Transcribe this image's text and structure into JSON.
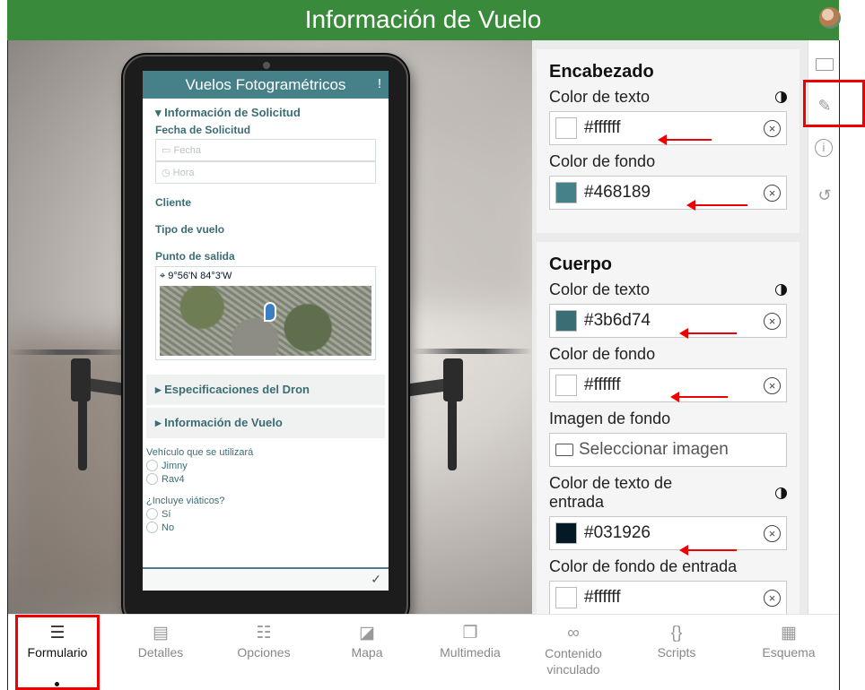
{
  "app": {
    "title": "Información de Vuelo"
  },
  "preview": {
    "form_title": "Vuelos Fotogramétricos",
    "header_icon": "!",
    "sections": {
      "solicitud": "Información de Solicitud",
      "dron": "Especificaciones del Dron",
      "vuelo": "Información de Vuelo"
    },
    "fields": {
      "fecha_solicitud": "Fecha de Solicitud",
      "fecha_placeholder": "Fecha",
      "hora_placeholder": "Hora",
      "cliente": "Cliente",
      "tipo_vuelo": "Tipo de vuelo",
      "punto_salida": "Punto de salida",
      "coordenadas": "9°56'N 84°3'W",
      "vehiculo": "Vehículo que se utilizará",
      "vehiculo_options": [
        "Jimny",
        "Rav4"
      ],
      "viaticos": "¿Incluye viáticos?",
      "viaticos_options": [
        "Sí",
        "No"
      ]
    }
  },
  "panel": {
    "encabezado": {
      "title": "Encabezado",
      "text_color_label": "Color de texto",
      "text_color": "#ffffff",
      "bg_color_label": "Color de fondo",
      "bg_color": "#468189"
    },
    "cuerpo": {
      "title": "Cuerpo",
      "text_color_label": "Color de texto",
      "text_color": "#3b6d74",
      "bg_color_label": "Color de fondo",
      "bg_color": "#ffffff",
      "bg_image_label": "Imagen de fondo",
      "bg_image_button": "Seleccionar imagen",
      "input_text_color_label": "Color de texto de entrada",
      "input_text_color": "#031926",
      "input_bg_color_label": "Color de fondo de entrada",
      "input_bg_color": "#ffffff"
    }
  },
  "tabs": [
    {
      "label": "Formulario",
      "icon": "form-icon",
      "active": true
    },
    {
      "label": "Detalles",
      "icon": "details-icon"
    },
    {
      "label": "Opciones",
      "icon": "options-icon"
    },
    {
      "label": "Mapa",
      "icon": "map-icon"
    },
    {
      "label": "Multimedia",
      "icon": "multimedia-icon"
    },
    {
      "label": "Contenido vinculado",
      "icon": "link-icon"
    },
    {
      "label": "Scripts",
      "icon": "scripts-icon"
    },
    {
      "label": "Esquema",
      "icon": "schema-icon"
    }
  ],
  "colors": {
    "topbar": "#3a8a3c",
    "annotation": "#ee0000"
  }
}
